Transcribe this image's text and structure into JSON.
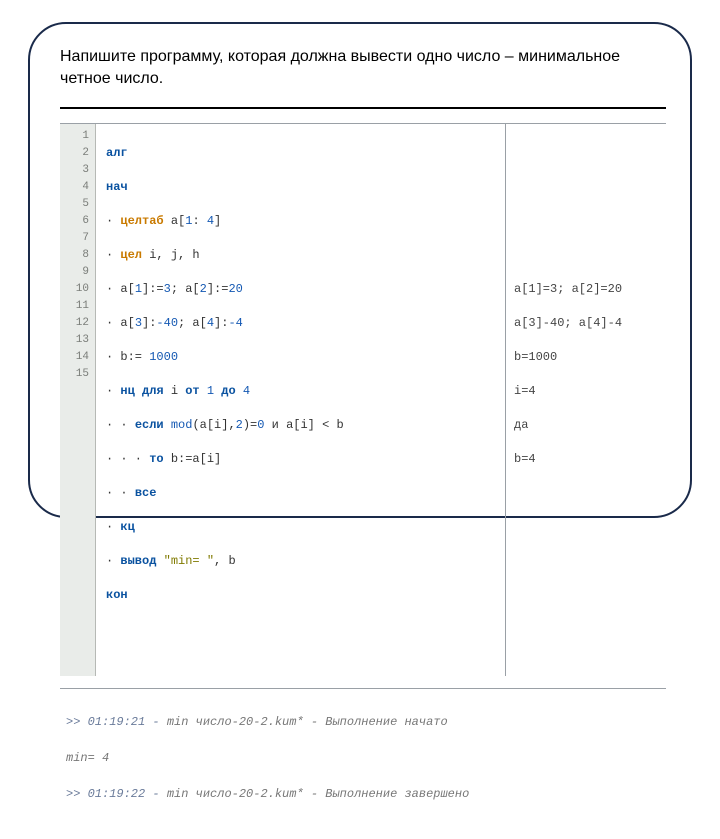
{
  "task": "Напишите программу, которая должна вывести одно число – минимальное четное число.",
  "gutter": [
    "1",
    "2",
    "3",
    "4",
    "5",
    "6",
    "7",
    "8",
    "9",
    "10",
    "11",
    "12",
    "13",
    "14",
    "15"
  ],
  "code": {
    "l1_kw": "алг",
    "l2_kw": "нач",
    "l3_dot": "· ",
    "l3_type": "целтаб ",
    "l3_rest1": "a[",
    "l3_n1": "1",
    "l3_rest2": ": ",
    "l3_n2": "4",
    "l3_rest3": "]",
    "l4_dot": "· ",
    "l4_type": "цел ",
    "l4_rest": "i, j, h",
    "l5_dot": "· ",
    "l5_a": "a[",
    "l5_n1": "1",
    "l5_b": "]:=",
    "l5_n2": "3",
    "l5_c": "; a[",
    "l5_n3": "2",
    "l5_d": "]:=",
    "l5_n4": "20",
    "l6_dot": "· ",
    "l6_a": "a[",
    "l6_n1": "3",
    "l6_b": "]:",
    "l6_n2": "-40",
    "l6_c": "; a[",
    "l6_n3": "4",
    "l6_d": "]:",
    "l6_n4": "-4",
    "l7_dot": "· ",
    "l7_a": "b:= ",
    "l7_n": "1000",
    "l8_dot": "· ",
    "l8_kw1": "нц для ",
    "l8_a": "i ",
    "l8_kw2": "от ",
    "l8_n1": "1",
    "l8_kw3": " до ",
    "l8_n2": "4",
    "l9_dot": "· · ",
    "l9_kw": "если ",
    "l9_fn": "mod",
    "l9_a": "(a[i],",
    "l9_n1": "2",
    "l9_b": ")=",
    "l9_n2": "0",
    "l9_c": " и a[i] < b",
    "l10_dot": "· · · ",
    "l10_kw": "то ",
    "l10_a": "b:=a[i]",
    "l11_dot": "· · ",
    "l11_kw": "все",
    "l12_dot": "· ",
    "l12_kw": "кц",
    "l13_dot": "· ",
    "l13_kw": "вывод ",
    "l13_str": "\"min= \"",
    "l13_a": ", b",
    "l14_kw": "кон"
  },
  "side": {
    "s5": "a[1]=3; a[2]=20",
    "s6": "a[3]-40; a[4]-4",
    "s7": "b=1000",
    "s8": "i=4",
    "s9": "да",
    "s10": "b=4"
  },
  "console": {
    "c1a": ">> 01:19:21 - ",
    "c1b": "min число-20-2.kum*",
    "c1c": " - Выполнение начато",
    "c2": "min= 4",
    "c3a": ">> 01:19:22 - ",
    "c3b": "min число-20-2.kum*",
    "c3c": " - Выполнение завершено"
  }
}
